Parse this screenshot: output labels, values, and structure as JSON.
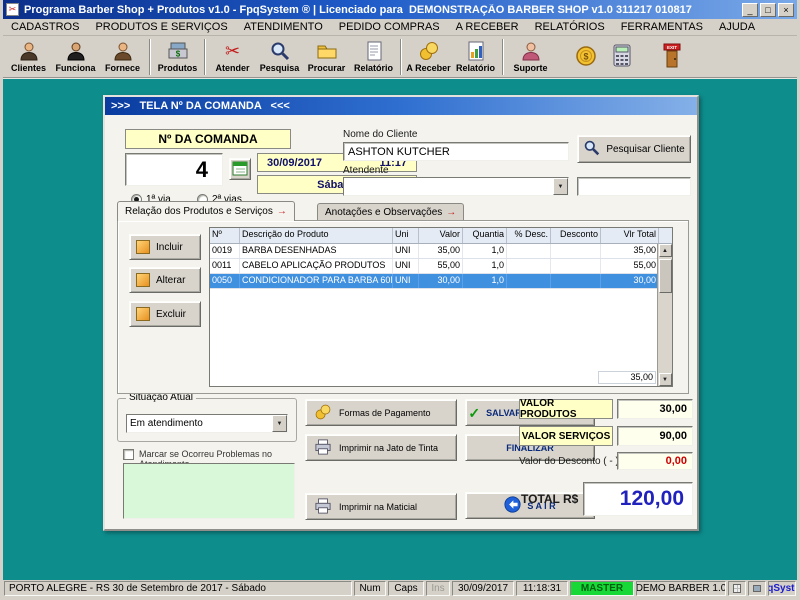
{
  "glyphs": {
    "minimize": "_",
    "maximize": "□",
    "close": "×",
    "dropdown": "▼",
    "up": "▲",
    "down": "▼",
    "tab_arrow": "→",
    "check": "✓",
    "scissors": "✂"
  },
  "window": {
    "title": "Programa Barber Shop + Produtos v1.0 - FpqSystem ® | Licenciado para  DEMONSTRAÇÃO BARBER SHOP v1.0 311217 010817"
  },
  "menu": {
    "items": [
      "CADASTROS",
      "PRODUTOS E SERVIÇOS",
      "ATENDIMENTO",
      "PEDIDO COMPRAS",
      "A RECEBER",
      "RELATÓRIOS",
      "FERRAMENTAS",
      "AJUDA"
    ]
  },
  "toolbar": {
    "items": [
      {
        "label": "Clientes",
        "icon": "clients-icon"
      },
      {
        "label": "Funciona",
        "icon": "employees-icon"
      },
      {
        "label": "Fornece",
        "icon": "suppliers-icon"
      },
      {
        "label": "Produtos",
        "icon": "products-icon"
      },
      {
        "label": "Atender",
        "icon": "attend-icon"
      },
      {
        "label": "Pesquisa",
        "icon": "search-icon"
      },
      {
        "label": "Procurar",
        "icon": "folder-icon"
      },
      {
        "label": "Relatório",
        "icon": "report-icon"
      },
      {
        "label": "A Receber",
        "icon": "receivables-icon"
      },
      {
        "label": "Relatório",
        "icon": "report-chart-icon"
      },
      {
        "label": "Suporte",
        "icon": "support-icon"
      },
      {
        "label": "",
        "icon": "coins-icon"
      },
      {
        "label": "",
        "icon": "calculator-icon"
      },
      {
        "label": "",
        "icon": "exit-icon"
      }
    ]
  },
  "dialog": {
    "title": ">>>   TELA Nº DA COMANDA   <<<",
    "comanda": {
      "label": "Nº DA COMANDA",
      "number": "4",
      "date": "30/09/2017",
      "time": "11:17",
      "weekday": "Sábado",
      "via1": "1ª via",
      "via2": "2ª vias"
    },
    "client": {
      "label": "Nome do Cliente",
      "value": "ASHTON KUTCHER",
      "search_button": "Pesquisar Cliente"
    },
    "attendant": {
      "label": "Atendente",
      "value": "",
      "extra_value": ""
    },
    "tabs": [
      {
        "label": "Relação dos Produtos e Serviços"
      },
      {
        "label": "Anotações e Observações"
      }
    ],
    "actions": {
      "incluir": "Incluir",
      "alterar": "Alterar",
      "excluir": "Excluir"
    },
    "grid": {
      "headers": [
        "Nº",
        "Descrição do Produto",
        "Uni",
        "Valor",
        "Quantia",
        "% Desc.",
        "Desconto",
        "Vlr Total"
      ],
      "rows": [
        {
          "num": "0019",
          "desc": "BARBA DESENHADAS",
          "uni": "UNI",
          "valor": "35,00",
          "qtd": "1,0",
          "pdesc": "",
          "desconto": "",
          "total": "35,00"
        },
        {
          "num": "0011",
          "desc": "CABELO APLICAÇÃO PRODUTOS",
          "uni": "UNI",
          "valor": "55,00",
          "qtd": "1,0",
          "pdesc": "",
          "desconto": "",
          "total": "55,00"
        },
        {
          "num": "0050",
          "desc": "CONDICIONADOR PARA BARBA 60ML",
          "uni": "UNI",
          "valor": "30,00",
          "qtd": "1,0",
          "pdesc": "",
          "desconto": "",
          "total": "30,00"
        }
      ],
      "footer_total": "35,00"
    },
    "situacao": {
      "label": "Situação Atual",
      "value": "Em atendimento",
      "checkbox_label": "Marcar se Ocorreu Problemas no Atendimento",
      "notes": ""
    },
    "buttons": {
      "formas_pagamento": "Formas de Pagamento",
      "salvar": "SALVAR  ATENDIMENTO",
      "imprimir_jato": "Imprimir na Jato de Tinta",
      "finalizar": "FINALIZAR",
      "imprimir_matricial": "Imprimir na Maticial",
      "sair": "S A I R"
    },
    "totals": {
      "valor_produtos_label": "VALOR PRODUTOS",
      "valor_produtos": "30,00",
      "valor_servicos_label": "VALOR SERVIÇOS",
      "valor_servicos": "90,00",
      "desconto_label": "Valor do Desconto ( - )",
      "desconto": "0,00",
      "total_label": "TOTAL R$",
      "total": "120,00"
    }
  },
  "statusbar": {
    "location": "PORTO ALEGRE - RS 30 de Setembro de 2017 - Sábado ",
    "num": "Num",
    "caps": "Caps",
    "ins": "Ins",
    "date": "30/09/2017",
    "time": "11:18:31",
    "master": "MASTER",
    "demo": "DEMO BARBER 1.0",
    "brand": "FpqSystem"
  }
}
